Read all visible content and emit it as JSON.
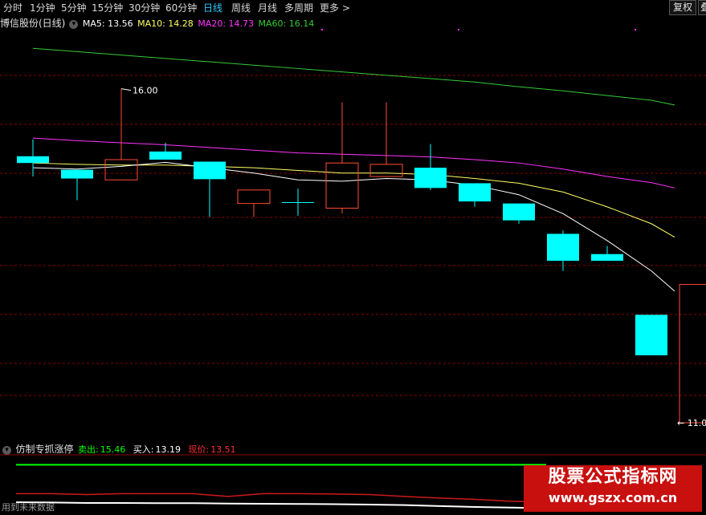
{
  "toolbar": {
    "tabs": [
      "分时",
      "1分钟",
      "5分钟",
      "15分钟",
      "30分钟",
      "60分钟",
      "日线",
      "周线",
      "月线",
      "多周期",
      "更多 >"
    ],
    "active_tab": "日线",
    "right_button": "复权",
    "right_button_cut": "叠"
  },
  "main_header": {
    "title": "博信股份(日线)",
    "ma5": "MA5: 13.56",
    "ma10": "MA10: 14.28",
    "ma20": "MA20: 14.73",
    "ma60": "MA60: 16.14"
  },
  "annotations": {
    "high_label": "16.00",
    "low_label": "11.0"
  },
  "sub_header": {
    "title": "仿制专抓涨停",
    "sell_label": "卖出:",
    "sell_value": "15.46",
    "buy_label": "买入:",
    "buy_value": "13.19",
    "price_label": "现价:",
    "price_value": "13.51"
  },
  "footer_note": "用到未来数据",
  "watermark": {
    "line1": "股票公式指标网",
    "line2": "www.gszx.com.cn"
  },
  "colors": {
    "up": "#ff4b35",
    "down": "#00ffff",
    "ma5": "#ffffff",
    "ma10": "#ffff66",
    "ma20": "#ff33ff",
    "ma60": "#33cc33",
    "grid": "#8b0000",
    "sell": "#00ff00",
    "buy": "#ffffff",
    "price": "#ff3030"
  },
  "chart_data": {
    "type": "candlestick",
    "price_range": [
      11.0,
      16.6
    ],
    "candles": [
      {
        "o": 14.95,
        "h": 15.2,
        "l": 14.65,
        "c": 14.85,
        "dir": "down"
      },
      {
        "o": 14.75,
        "h": 14.75,
        "l": 14.3,
        "c": 14.62,
        "dir": "down"
      },
      {
        "o": 14.6,
        "h": 15.95,
        "l": 14.6,
        "c": 14.9,
        "dir": "up"
      },
      {
        "o": 15.02,
        "h": 15.15,
        "l": 14.9,
        "c": 14.9,
        "dir": "down"
      },
      {
        "o": 14.87,
        "h": 14.87,
        "l": 14.05,
        "c": 14.61,
        "dir": "down"
      },
      {
        "o": 14.25,
        "h": 14.45,
        "l": 14.05,
        "c": 14.45,
        "dir": "up"
      },
      {
        "o": 14.27,
        "h": 14.47,
        "l": 14.07,
        "c": 14.27,
        "dir": "down"
      },
      {
        "o": 14.18,
        "h": 15.75,
        "l": 14.1,
        "c": 14.85,
        "dir": "up"
      },
      {
        "o": 14.65,
        "h": 15.75,
        "l": 14.65,
        "c": 14.83,
        "dir": "up"
      },
      {
        "o": 14.78,
        "h": 15.13,
        "l": 14.45,
        "c": 14.48,
        "dir": "down"
      },
      {
        "o": 14.55,
        "h": 14.55,
        "l": 14.2,
        "c": 14.28,
        "dir": "down"
      },
      {
        "o": 14.25,
        "h": 14.25,
        "l": 13.95,
        "c": 14.0,
        "dir": "down"
      },
      {
        "o": 13.8,
        "h": 13.85,
        "l": 13.25,
        "c": 13.4,
        "dir": "down"
      },
      {
        "o": 13.5,
        "h": 13.62,
        "l": 13.4,
        "c": 13.4,
        "dir": "down"
      },
      {
        "o": 12.6,
        "h": 12.6,
        "l": 12.0,
        "c": 12.0,
        "dir": "down"
      },
      {
        "o": 11.0,
        "h": 13.05,
        "l": 11.0,
        "c": 13.05,
        "dir": "up"
      }
    ],
    "ma5": [
      14.78,
      14.76,
      14.8,
      14.86,
      14.78,
      14.7,
      14.6,
      14.58,
      14.62,
      14.6,
      14.52,
      14.38,
      14.1,
      13.7,
      13.25,
      12.95
    ],
    "ma10": [
      14.85,
      14.83,
      14.82,
      14.82,
      14.8,
      14.78,
      14.74,
      14.7,
      14.7,
      14.68,
      14.62,
      14.55,
      14.42,
      14.2,
      13.95,
      13.75
    ],
    "ma20": [
      15.22,
      15.18,
      15.15,
      15.12,
      15.08,
      15.04,
      15.0,
      14.98,
      14.96,
      14.94,
      14.9,
      14.85,
      14.76,
      14.65,
      14.56,
      14.48
    ],
    "ma60": [
      16.55,
      16.5,
      16.45,
      16.4,
      16.35,
      16.3,
      16.25,
      16.2,
      16.15,
      16.1,
      16.05,
      15.98,
      15.92,
      15.85,
      15.78,
      15.71
    ],
    "indicator_sell": [
      15.46,
      15.46,
      15.46,
      15.46,
      15.46,
      15.46,
      15.46,
      15.46,
      15.46,
      15.46,
      15.46,
      15.46,
      15.46,
      15.46,
      15.46,
      15.46
    ],
    "indicator_price": [
      13.95,
      13.95,
      13.9,
      13.95,
      13.95,
      13.95,
      13.8,
      13.95,
      13.95,
      13.93,
      13.9,
      13.8,
      13.72,
      13.65,
      13.55,
      13.51
    ],
    "indicator_buy": [
      13.5,
      13.49,
      13.46,
      13.46,
      13.45,
      13.45,
      13.43,
      13.42,
      13.41,
      13.4,
      13.38,
      13.35,
      13.3,
      13.25,
      13.22,
      13.19
    ]
  }
}
